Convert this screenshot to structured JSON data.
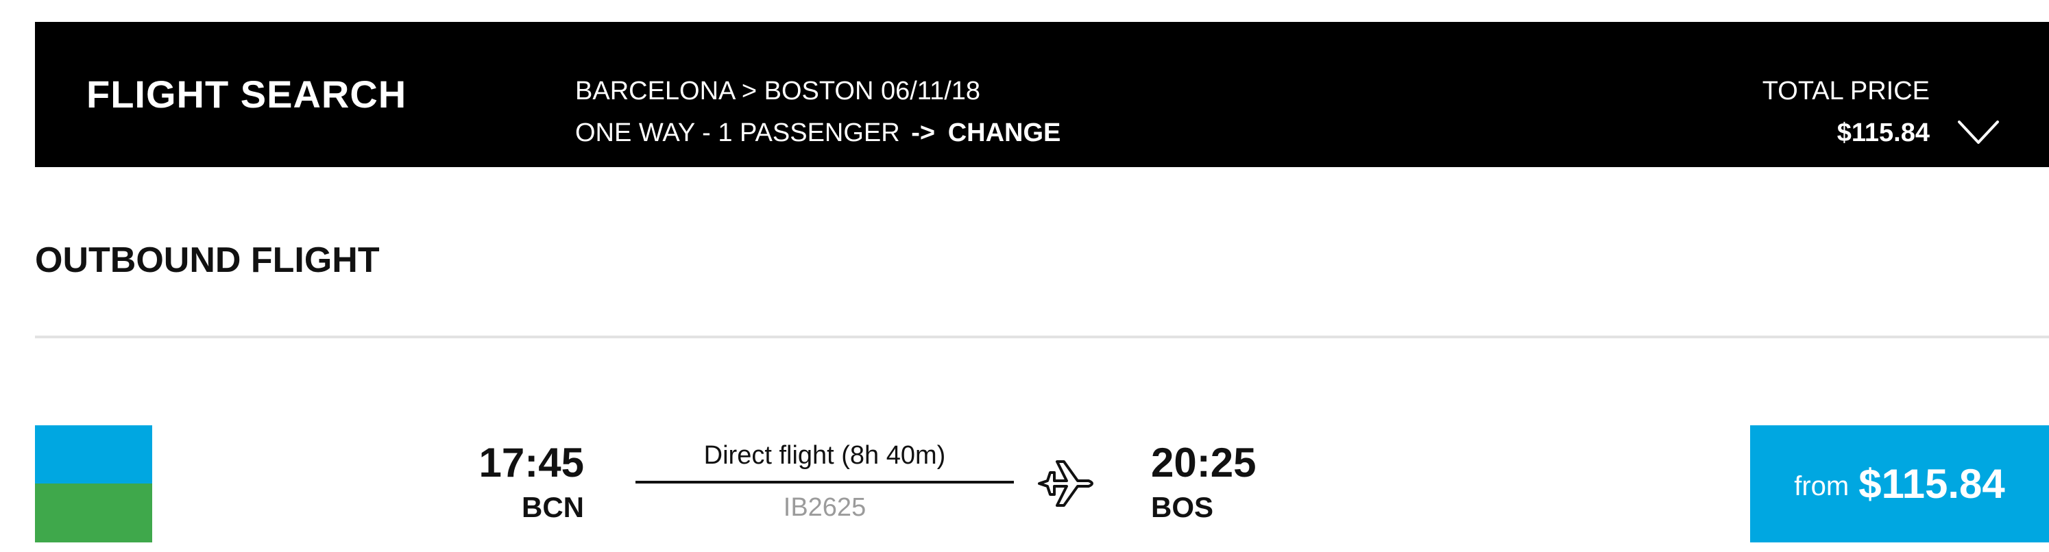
{
  "header": {
    "title": "FLIGHT SEARCH",
    "route": "BARCELONA > BOSTON 06/11/18",
    "trip_summary": "ONE WAY - 1 PASSENGER",
    "change_arrow": "->",
    "change_label": "CHANGE",
    "total_price_label": "TOTAL PRICE",
    "total_price_value": "$115.84",
    "toggle_icon": "chevron-down-icon"
  },
  "section": {
    "title": "OUTBOUND FLIGHT"
  },
  "flight": {
    "airline_logo_colors": {
      "top": "#00a7e1",
      "bottom": "#3fa84b"
    },
    "departure_time": "17:45",
    "departure_code": "BCN",
    "duration_text": "Direct flight (8h 40m)",
    "flight_number": "IB2625",
    "plane_icon": "airplane-icon",
    "arrival_time": "20:25",
    "arrival_code": "BOS",
    "price_prefix": "from",
    "price": "$115.84"
  },
  "colors": {
    "header_bg": "#000000",
    "accent": "#00a7e1",
    "muted_text": "#9b9b9b",
    "divider": "#e2e2e2"
  }
}
